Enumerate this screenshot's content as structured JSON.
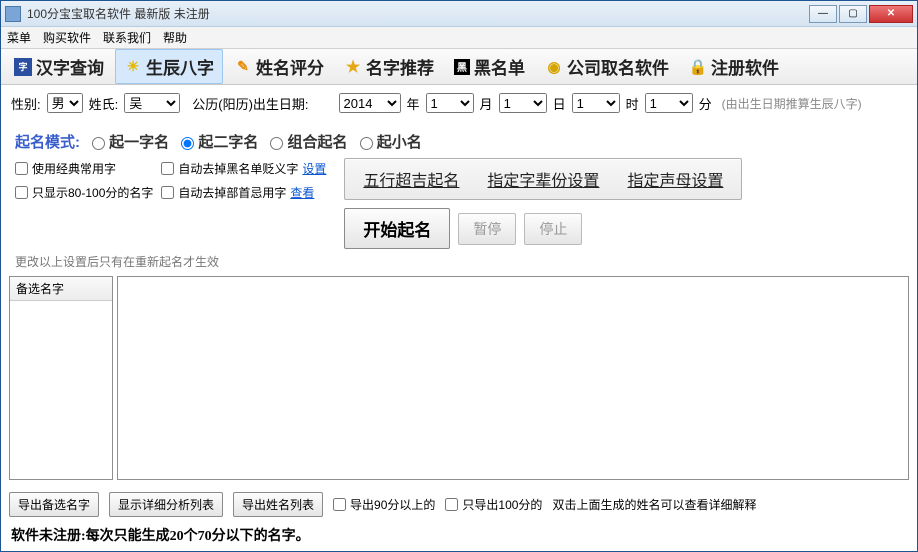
{
  "titlebar": {
    "title": "100分宝宝取名软件 最新版  未注册"
  },
  "menubar": {
    "items": [
      "菜单",
      "购买软件",
      "联系我们",
      "帮助"
    ]
  },
  "toolbar": {
    "items": [
      {
        "label": "汉字查询",
        "icon": "icon-dict-blue"
      },
      {
        "label": "生辰八字",
        "icon": "icon-sun",
        "active": true
      },
      {
        "label": "姓名评分",
        "icon": "icon-pencil"
      },
      {
        "label": "名字推荐",
        "icon": "icon-star"
      },
      {
        "label": "黑名单",
        "icon": "icon-blacklist"
      },
      {
        "label": "公司取名软件",
        "icon": "icon-coin"
      },
      {
        "label": "注册软件",
        "icon": "icon-lock"
      }
    ]
  },
  "form": {
    "gender_label": "性别:",
    "gender_value": "男",
    "surname_label": "姓氏:",
    "surname_value": "吴",
    "birthdate_label": "公历(阳历)出生日期:",
    "year_value": "2014",
    "year_unit": "年",
    "month_value": "1",
    "month_unit": "月",
    "day_value": "1",
    "day_unit": "日",
    "hour_value": "1",
    "hour_unit": "时",
    "minute_value": "1",
    "minute_unit": "分",
    "note": "(由出生日期推算生辰八字)"
  },
  "mode": {
    "label": "起名模式:",
    "options": [
      "起一字名",
      "起二字名",
      "组合起名",
      "起小名"
    ],
    "selected": 1
  },
  "opts": {
    "col1": [
      "使用经典常用字",
      "只显示80-100分的名字"
    ],
    "col2": [
      {
        "label": "自动去掉黑名单贬义字",
        "link": "设置"
      },
      {
        "label": "自动去掉部首忌用字",
        "link": "查看"
      }
    ],
    "hint": "更改以上设置后只有在重新起名才生效"
  },
  "raised": {
    "items": [
      "五行超吉起名",
      "指定字辈份设置",
      "指定声母设置"
    ]
  },
  "actions": {
    "start": "开始起名",
    "pause": "暂停",
    "stop": "停止"
  },
  "lists": {
    "candidates_header": "备选名字"
  },
  "bottom": {
    "export_candidates": "导出备选名字",
    "show_detail_list": "显示详细分析列表",
    "export_name_list": "导出姓名列表",
    "export_90": "导出90分以上的",
    "export_100": "只导出100分的",
    "dbl_hint": "双击上面生成的姓名可以查看详细解释"
  },
  "footer": "软件未注册:每次只能生成20个70分以下的名字。"
}
